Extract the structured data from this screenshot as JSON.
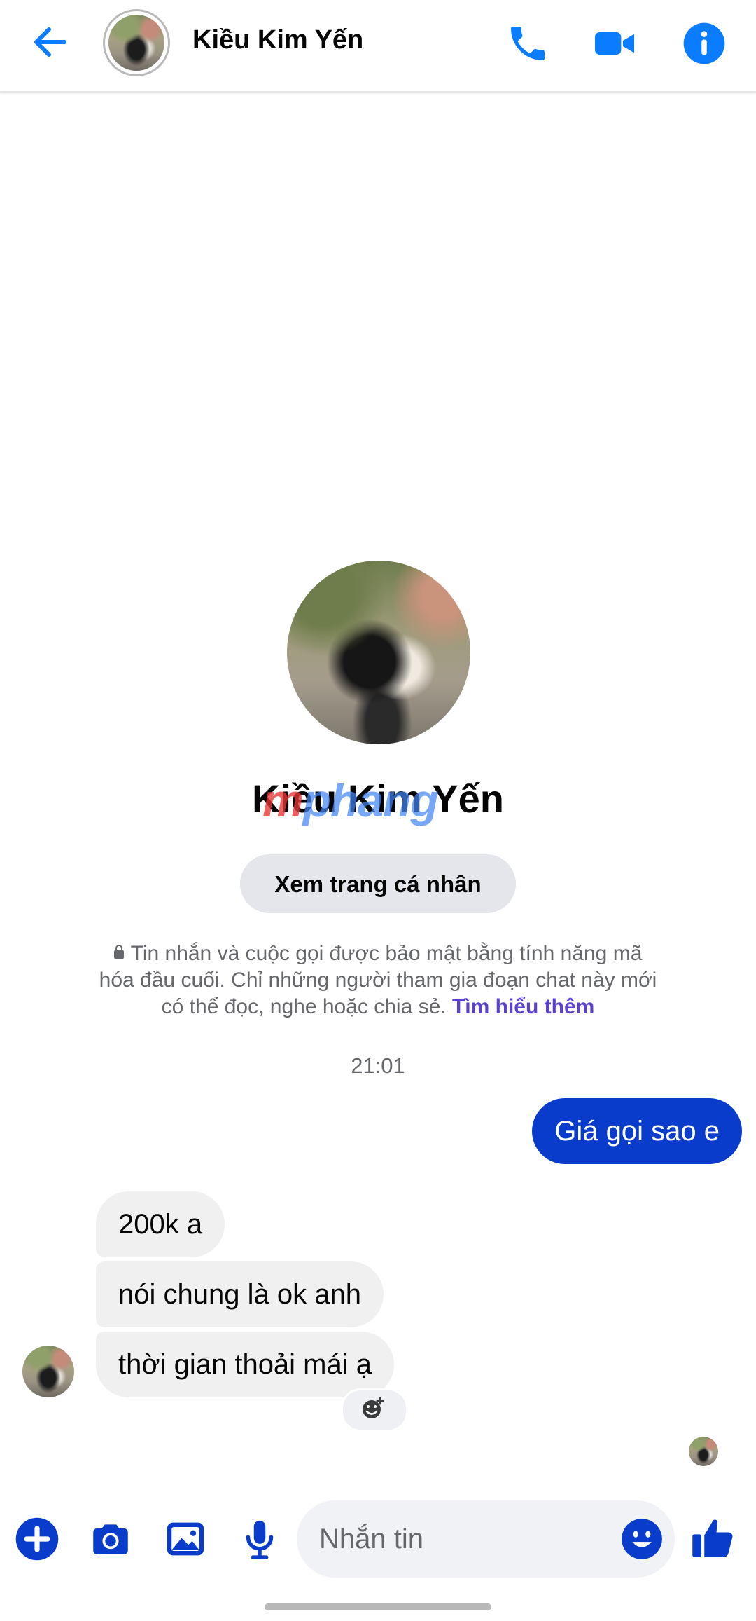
{
  "header": {
    "contact_name": "Kiều Kim Yến",
    "icons": [
      "back-arrow-icon",
      "phone-icon",
      "video-camera-icon",
      "info-icon"
    ]
  },
  "profile": {
    "name": "Kiều Kim Yến",
    "view_profile_label": "Xem trang cá nhân"
  },
  "watermark": {
    "part1": "m",
    "part2": "phang"
  },
  "e2e_notice": {
    "text": "Tin nhắn và cuộc gọi được bảo mật bằng tính năng mã hóa đầu cuối. Chỉ những người tham gia đoạn chat này mới có thể đọc, nghe hoặc chia sẻ.",
    "link": "Tìm hiểu thêm"
  },
  "conversation": {
    "timestamp": "21:01",
    "outgoing": [
      "Giá gọi sao e"
    ],
    "incoming": [
      "200k a",
      "nói chung là ok anh",
      "thời gian thoải mái ạ"
    ]
  },
  "composer": {
    "placeholder": "Nhắn tin",
    "icons": [
      "plus-icon",
      "camera-icon",
      "gallery-icon",
      "microphone-icon",
      "emoji-icon",
      "thumbs-up-icon"
    ]
  },
  "colors": {
    "accent": "#0a7cff",
    "outgoing_bubble": "#0a3ccc",
    "incoming_bubble": "#f0f0f0",
    "link": "#5b3fd1"
  }
}
